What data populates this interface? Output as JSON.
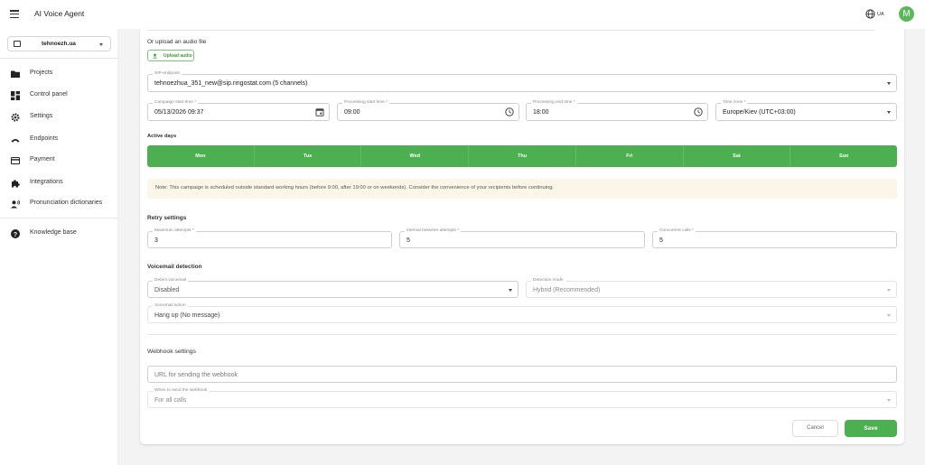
{
  "header": {
    "title": "AI Voice Agent",
    "lang": "UA",
    "avatar_letter": "M"
  },
  "sidebar": {
    "workspace": "tehnoezh.ua",
    "items": [
      {
        "label": "Projects",
        "icon": "folder-icon"
      },
      {
        "label": "Control panel",
        "icon": "dashboard-icon"
      },
      {
        "label": "Settings",
        "icon": "gear-icon"
      },
      {
        "label": "Endpoints",
        "icon": "phone-icon"
      },
      {
        "label": "Payment",
        "icon": "credit-card-icon"
      },
      {
        "label": "Integrations",
        "icon": "puzzle-icon"
      },
      {
        "label": "Pronunciation dictionaries",
        "icon": "speaker-icon"
      },
      {
        "label": "Knowledge base",
        "icon": "help-icon"
      }
    ]
  },
  "form": {
    "upload_heading": "Or upload an audio file",
    "upload_button": "Upload audio",
    "sip": {
      "label": "SIP-endpoint",
      "value": "tehnoezhua_351_new@sip.ringostat.com (5 channels)"
    },
    "campaign_start": {
      "label": "Campaign start time *",
      "value": "05/13/2026 09:37"
    },
    "proc_start": {
      "label": "Processing start time *",
      "value": "09:00"
    },
    "proc_end": {
      "label": "Processing end time *",
      "value": "18:00"
    },
    "timezone": {
      "label": "Time zone *",
      "value": "Europe/Kiev (UTC+03:00)"
    },
    "active_days_heading": "Active days",
    "days": [
      "Mon",
      "Tue",
      "Wed",
      "Thu",
      "Fri",
      "Sat",
      "Sun"
    ],
    "note": "Note: This campaign is scheduled outside standard working hours (before 9:00, after 19:00 or on weekends). Consider the convenience of your recipients before continuing.",
    "retry_heading": "Retry settings",
    "max_attempts": {
      "label": "Maximum attempts *",
      "value": "3"
    },
    "interval": {
      "label": "Interval between attempts *",
      "value": "5"
    },
    "concurrent": {
      "label": "Concurrent calls *",
      "value": "5"
    },
    "voicemail_heading": "Voicemail detection",
    "detect_voicemail": {
      "label": "Detect voicemail",
      "value": "Disabled"
    },
    "detection_mode": {
      "label": "Detection mode",
      "value": "Hybrid (Recommended)"
    },
    "voicemail_action": {
      "label": "Voicemail action",
      "value": "Hang up (No message)"
    },
    "webhook_heading": "Webhook settings",
    "webhook_url_placeholder": "URL for sending the webhook",
    "webhook_when": {
      "label": "When to send the webhook",
      "value": "For all calls"
    },
    "cancel": "Cancel",
    "save": "Save"
  },
  "colors": {
    "accent": "#4caf50",
    "note_bg": "#fbf6e7"
  }
}
